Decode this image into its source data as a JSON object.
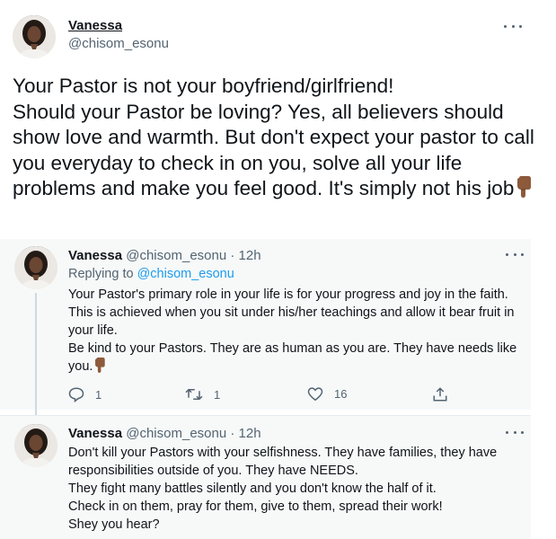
{
  "main_tweet": {
    "name": "Vanessa",
    "handle": "@chisom_esonu",
    "text_lines": [
      "Your Pastor is not your boyfriend/girlfriend!",
      "Should your Pastor be loving? Yes, all believers should show love and warmth.  But don't expect your pastor to call you everyday to check in on you, solve all your life problems and make you feel good. It's simply not his job"
    ],
    "emoji": "point-down-icon"
  },
  "reply1": {
    "name": "Vanessa",
    "meta": "@chisom_esonu · 12h",
    "replying_prefix": "Replying to ",
    "replying_handle": "@chisom_esonu",
    "paragraph1": "Your Pastor's primary role in your life is for your progress and joy in the faith. This is achieved when you sit under his/her teachings and allow it bear fruit in your life.",
    "paragraph2": "Be kind to your Pastors. They are as human as you are. They have needs like you.",
    "reply_count": "1",
    "retweet_count": "1",
    "like_count": "16"
  },
  "reply2": {
    "name": "Vanessa",
    "meta": "@chisom_esonu · 12h",
    "paragraph1": "Don't kill your Pastors with your selfishness. They have families, they have responsibilities outside of you. They have NEEDS.",
    "paragraph2": "They fight many battles silently and you don't know the half of it.",
    "paragraph3": "Check in on them, pray for them, give to them, spread their work!",
    "paragraph4": "Shey you hear?"
  },
  "colors": {
    "accent": "#1d9bf0",
    "muted": "#536471",
    "reply_bg": "#f7f9f9"
  }
}
